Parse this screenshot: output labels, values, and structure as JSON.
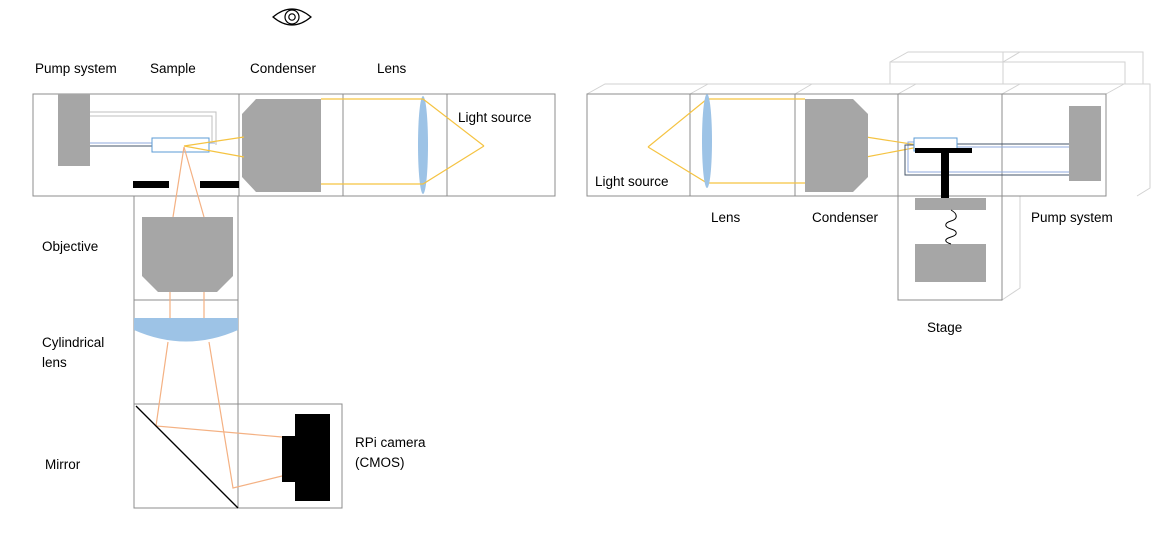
{
  "left": {
    "labels": {
      "pump_system": "Pump system",
      "sample": "Sample",
      "condenser": "Condenser",
      "lens": "Lens",
      "light_source": "Light source",
      "objective": "Objective",
      "cylindrical_lens_1": "Cylindrical",
      "cylindrical_lens_2": "lens",
      "mirror": "Mirror",
      "camera_1": "RPi camera",
      "camera_2": "(CMOS)"
    }
  },
  "right": {
    "labels": {
      "light_source": "Light source",
      "lens": "Lens",
      "condenser": "Condenser",
      "pump_system": "Pump system",
      "stage": "Stage"
    }
  },
  "colors": {
    "module_outline": "#8c8c8c",
    "component_gray": "#a6a6a6",
    "lens_blue": "#9dc3e6",
    "illumination_ray": "#f5c342",
    "imaging_ray": "#f4b183"
  },
  "icons": {
    "viewer": "eye-icon"
  }
}
